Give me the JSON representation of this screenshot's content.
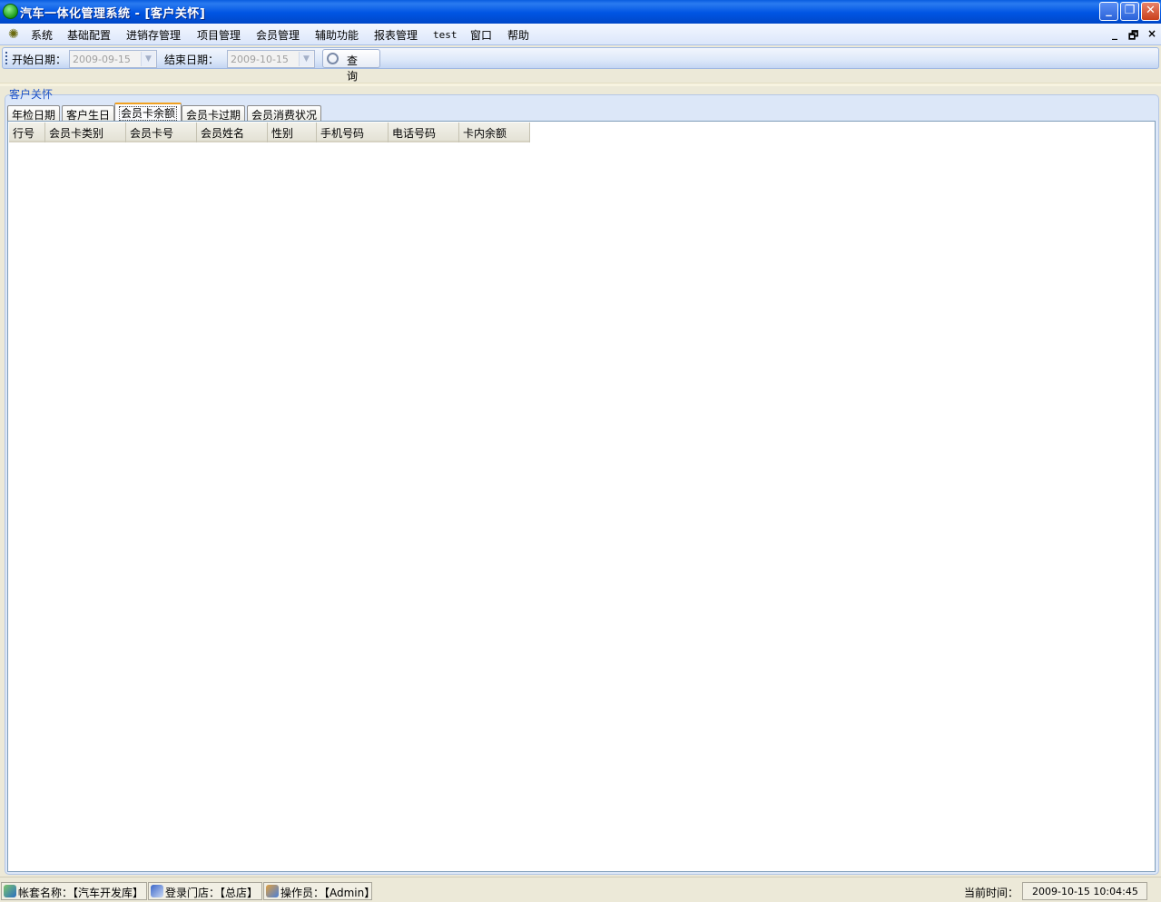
{
  "window": {
    "title": "汽车一体化管理系统 - [客户关怀]"
  },
  "menu": {
    "items": [
      "系统",
      "基础配置",
      "进销存管理",
      "项目管理",
      "会员管理",
      "辅助功能",
      "报表管理",
      "test",
      "窗口",
      "帮助"
    ],
    "mdi_min": "_",
    "mdi_restore": "🗗",
    "mdi_close": "×"
  },
  "toolbar": {
    "start_label": "开始日期：",
    "start_value": "2009-09-15",
    "end_label": "结束日期：",
    "end_value": "2009-10-15",
    "query_label": "查 询"
  },
  "group": {
    "title": "客户关怀"
  },
  "tabs": [
    "年检日期",
    "客户生日",
    "会员卡余额",
    "会员卡过期",
    "会员消费状况"
  ],
  "active_tab": 2,
  "table": {
    "columns": [
      "行号",
      "会员卡类别",
      "会员卡号",
      "会员姓名",
      "性别",
      "手机号码",
      "电话号码",
      "卡内余额"
    ]
  },
  "status": {
    "account": "帐套名称：【汽车开发库】",
    "store": "登录门店：【总店】",
    "operator": "操作员：【Admin】",
    "time_label": "当前时间：",
    "time_value": "2009-10-15 10:04:45"
  }
}
